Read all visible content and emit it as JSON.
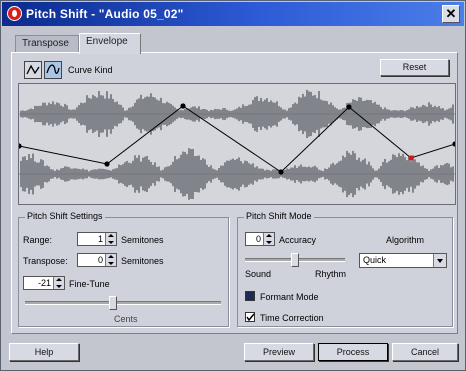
{
  "window": {
    "title": "Pitch Shift - \"Audio 05_02\"",
    "close_glyph": "✕"
  },
  "tabs": [
    {
      "label": "Transpose",
      "active": false
    },
    {
      "label": "Envelope",
      "active": true
    }
  ],
  "envelope": {
    "curve_kind_label": "Curve Kind",
    "curve_buttons": [
      {
        "icon": "curve-linear-icon",
        "pressed": false
      },
      {
        "icon": "curve-spline-icon",
        "pressed": true
      }
    ],
    "reset_label": "Reset"
  },
  "pitch_shift_settings": {
    "title": "Pitch Shift Settings",
    "range_label": "Range:",
    "range_value": "1",
    "range_unit": "Semitones",
    "transpose_label": "Transpose:",
    "transpose_value": "0",
    "transpose_unit": "Semitones",
    "finetune_value": "-21",
    "finetune_label": "Fine-Tune",
    "finetune_slider_fraction": 0.45,
    "cents_label": "Cents"
  },
  "pitch_shift_mode": {
    "title": "Pitch Shift Mode",
    "accuracy_value": "0",
    "accuracy_label": "Accuracy",
    "sound_label": "Sound",
    "rhythm_label": "Rhythm",
    "accuracy_slider_fraction": 0.5,
    "algorithm_label": "Algorithm",
    "algorithm_value": "Quick",
    "formant_mode_label": "Formant Mode",
    "formant_mode_checked": false,
    "time_correction_label": "Time Correction",
    "time_correction_checked": true
  },
  "footer": {
    "help_label": "Help",
    "preview_label": "Preview",
    "process_label": "Process",
    "cancel_label": "Cancel"
  },
  "colors": {
    "title_bar": "#0b2a8c",
    "waveform": "#6e7078",
    "envelope_line": "#000000",
    "selected_node": "#d01818"
  }
}
